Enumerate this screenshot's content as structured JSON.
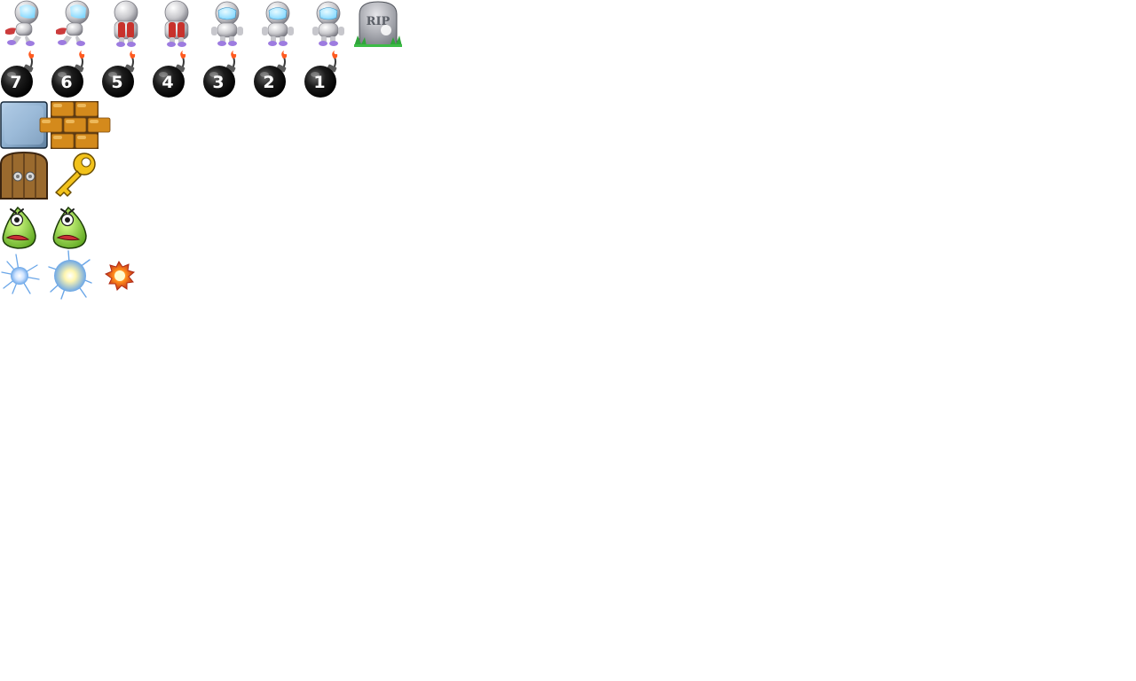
{
  "sprite_sheet": {
    "background": "#ffffff",
    "rows": [
      {
        "name": "player-row",
        "sprites": [
          {
            "name": "player-walk-left-1-icon",
            "kind": "player-helmet"
          },
          {
            "name": "player-walk-left-2-icon",
            "kind": "player-helmet"
          },
          {
            "name": "player-back-1-icon",
            "kind": "player-back"
          },
          {
            "name": "player-back-2-icon",
            "kind": "player-back"
          },
          {
            "name": "player-front-1-icon",
            "kind": "player-front"
          },
          {
            "name": "player-front-2-icon",
            "kind": "player-front"
          },
          {
            "name": "player-front-3-icon",
            "kind": "player-front"
          },
          {
            "name": "tombstone-icon",
            "kind": "tombstone",
            "engraving": "RIP"
          }
        ]
      },
      {
        "name": "bomb-row",
        "sprites": [
          {
            "name": "bomb-7-icon",
            "kind": "bomb",
            "label": "7"
          },
          {
            "name": "bomb-6-icon",
            "kind": "bomb",
            "label": "6"
          },
          {
            "name": "bomb-5-icon",
            "kind": "bomb",
            "label": "5"
          },
          {
            "name": "bomb-4-icon",
            "kind": "bomb",
            "label": "4"
          },
          {
            "name": "bomb-3-icon",
            "kind": "bomb",
            "label": "3"
          },
          {
            "name": "bomb-2-icon",
            "kind": "bomb",
            "label": "2"
          },
          {
            "name": "bomb-1-icon",
            "kind": "bomb",
            "label": "1"
          }
        ]
      },
      {
        "name": "tile-row",
        "sprites": [
          {
            "name": "stone-block-icon",
            "kind": "stone"
          },
          {
            "name": "brick-wall-icon",
            "kind": "brick"
          }
        ]
      },
      {
        "name": "door-key-row",
        "sprites": [
          {
            "name": "wooden-door-icon",
            "kind": "door"
          },
          {
            "name": "gold-key-icon",
            "kind": "key"
          }
        ]
      },
      {
        "name": "monster-row",
        "sprites": [
          {
            "name": "green-monster-1-icon",
            "kind": "monster"
          },
          {
            "name": "green-monster-2-icon",
            "kind": "monster"
          }
        ]
      },
      {
        "name": "explosion-row",
        "sprites": [
          {
            "name": "blue-spark-small-icon",
            "kind": "spark-small"
          },
          {
            "name": "blue-spark-large-icon",
            "kind": "spark-large"
          },
          {
            "name": "fire-explosion-icon",
            "kind": "fire"
          }
        ]
      }
    ],
    "colors": {
      "bomb": "#1b1b1b",
      "fuse_flame": "#ff5a1f",
      "helmet_visor": "#7fd6ff",
      "stone": "#8fb0cf",
      "brick": "#d48a1c",
      "wood": "#9a6a2e",
      "key": "#f2c21b",
      "monster": "#8fd63a",
      "spark": "#6aa6e8",
      "fire": "#ff8a1a"
    }
  }
}
